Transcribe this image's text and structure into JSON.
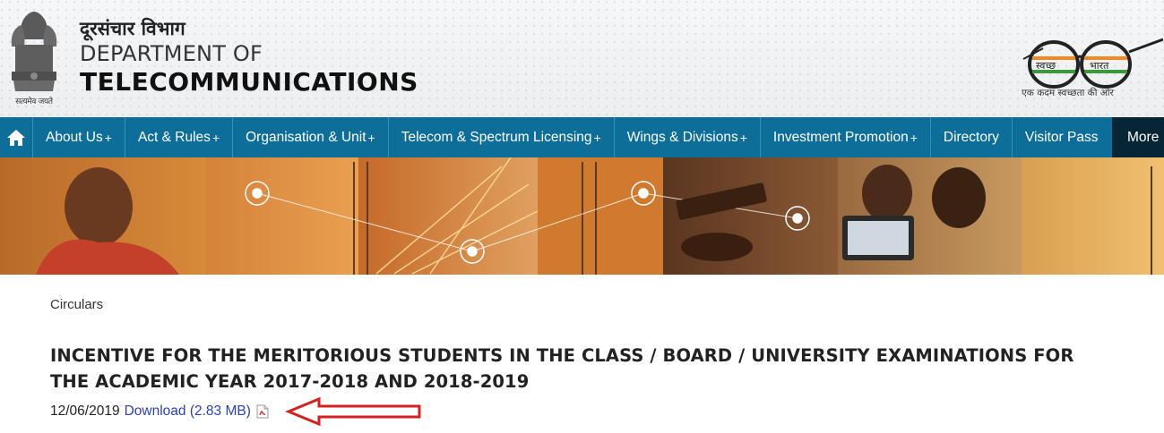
{
  "header": {
    "emblem_caption": "सत्यमेव जयते",
    "dept_hindi": "दूरसंचार विभाग",
    "dept_line1": "DEPARTMENT OF",
    "dept_line2": "TELECOMMUNICATIONS",
    "swachh_left": "स्वच्छ",
    "swachh_right": "भारत",
    "swachh_caption": "एक कदम स्वच्छता की ओर"
  },
  "nav": {
    "home_icon": "home-icon",
    "items": [
      {
        "label": "About Us",
        "plus": "+"
      },
      {
        "label": "Act & Rules",
        "plus": "+"
      },
      {
        "label": "Organisation & Unit",
        "plus": "+"
      },
      {
        "label": "Telecom & Spectrum Licensing",
        "plus": "+"
      },
      {
        "label": "Wings & Divisions",
        "plus": "+"
      },
      {
        "label": "Investment Promotion",
        "plus": "+"
      },
      {
        "label": "Directory",
        "plus": ""
      },
      {
        "label": "Visitor Pass",
        "plus": ""
      }
    ],
    "more": "More"
  },
  "content": {
    "breadcrumb": "Circulars",
    "title": "INCENTIVE FOR THE MERITORIOUS STUDENTS IN THE CLASS / BOARD / UNIVERSITY EXAMINATIONS FOR THE ACADEMIC YEAR 2017-2018 AND 2018-2019",
    "date": "12/06/2019",
    "download": "Download (2.83 MB)",
    "file_icon": "pdf-icon"
  },
  "colors": {
    "nav_bg": "#0d6e9a",
    "nav_more_bg": "#062535",
    "link": "#2a3fbf",
    "arrow": "#d42020"
  }
}
